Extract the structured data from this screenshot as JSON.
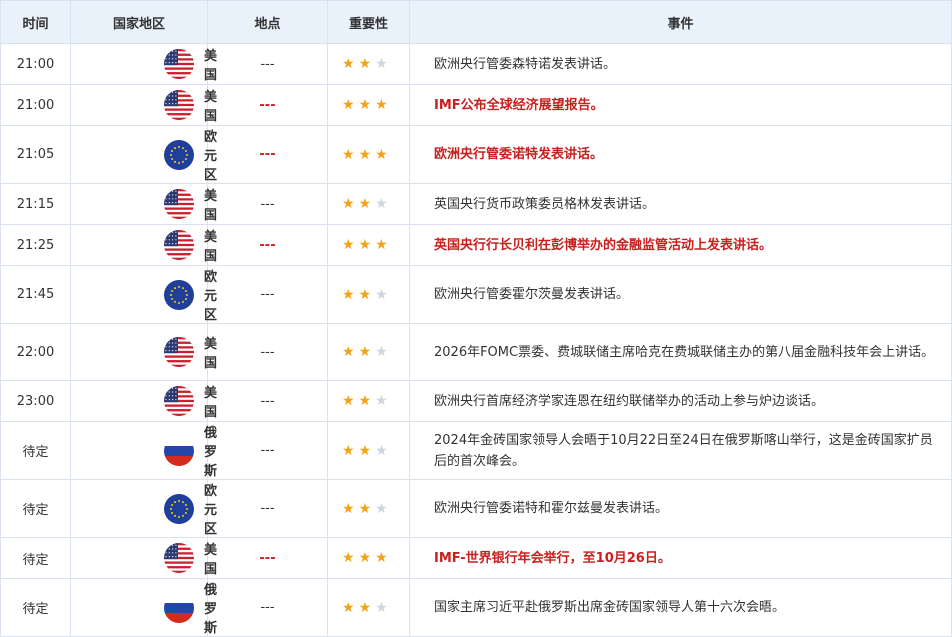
{
  "colors": {
    "header_bg": "#e9f1fb",
    "border": "#d9e2ee",
    "highlight": "#c8201e",
    "star_on": "#f3a21a",
    "star_off": "#cfd5dc"
  },
  "headers": {
    "time": "时间",
    "country": "国家地区",
    "location": "地点",
    "importance": "重要性",
    "event": "事件"
  },
  "rows": [
    {
      "time": "21:00",
      "country": "美国",
      "flag": "us-flag-icon",
      "location": "---",
      "stars": 2,
      "highlight": false,
      "event": "欧洲央行管委森特诺发表讲话。"
    },
    {
      "time": "21:00",
      "country": "美国",
      "flag": "us-flag-icon",
      "location": "---",
      "stars": 3,
      "highlight": true,
      "event": "IMF公布全球经济展望报告。"
    },
    {
      "time": "21:05",
      "country": "欧元区",
      "flag": "eu-flag-icon",
      "location": "---",
      "stars": 3,
      "highlight": true,
      "event": "欧洲央行管委诺特发表讲话。"
    },
    {
      "time": "21:15",
      "country": "美国",
      "flag": "us-flag-icon",
      "location": "---",
      "stars": 2,
      "highlight": false,
      "event": "英国央行货币政策委员格林发表讲话。"
    },
    {
      "time": "21:25",
      "country": "美国",
      "flag": "us-flag-icon",
      "location": "---",
      "stars": 3,
      "highlight": true,
      "event": "英国央行行长贝利在彭博举办的金融监管活动上发表讲话。"
    },
    {
      "time": "21:45",
      "country": "欧元区",
      "flag": "eu-flag-icon",
      "location": "---",
      "stars": 2,
      "highlight": false,
      "event": "欧洲央行管委霍尔茨曼发表讲话。"
    },
    {
      "time": "22:00",
      "country": "美国",
      "flag": "us-flag-icon",
      "location": "---",
      "stars": 2,
      "highlight": false,
      "event": "2026年FOMC票委、费城联储主席哈克在费城联储主办的第八届金融科技年会上讲话。"
    },
    {
      "time": "23:00",
      "country": "美国",
      "flag": "us-flag-icon",
      "location": "---",
      "stars": 2,
      "highlight": false,
      "event": "欧洲央行首席经济学家连恩在纽约联储举办的活动上参与炉边谈话。"
    },
    {
      "time": "待定",
      "country": "俄罗斯",
      "flag": "ru-flag-icon",
      "location": "---",
      "stars": 2,
      "highlight": false,
      "event": "2024年金砖国家领导人会晤于10月22日至24日在俄罗斯喀山举行，这是金砖国家扩员后的首次峰会。"
    },
    {
      "time": "待定",
      "country": "欧元区",
      "flag": "eu-flag-icon",
      "location": "---",
      "stars": 2,
      "highlight": false,
      "event": "欧洲央行管委诺特和霍尔兹曼发表讲话。"
    },
    {
      "time": "待定",
      "country": "美国",
      "flag": "us-flag-icon",
      "location": "---",
      "stars": 3,
      "highlight": true,
      "event": "IMF-世界银行年会举行，至10月26日。"
    },
    {
      "time": "待定",
      "country": "俄罗斯",
      "flag": "ru-flag-icon",
      "location": "---",
      "stars": 2,
      "highlight": false,
      "event": "国家主席习近平赴俄罗斯出席金砖国家领导人第十六次会晤。"
    }
  ]
}
